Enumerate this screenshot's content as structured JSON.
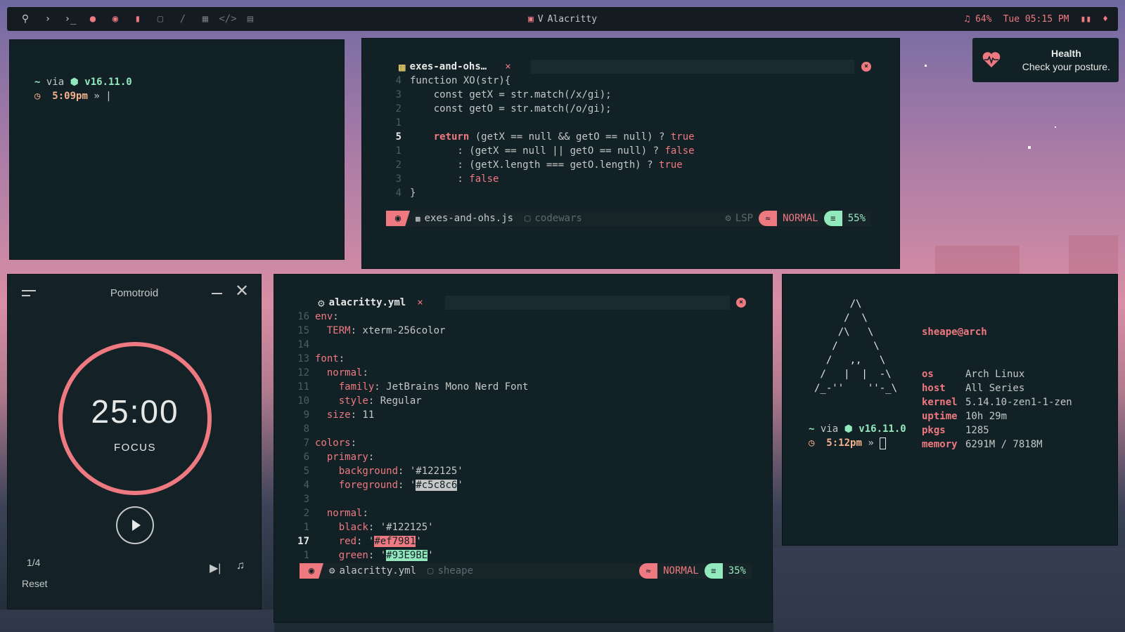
{
  "topbar": {
    "title": "Alacritty",
    "title_prefix": "V",
    "volume": "64%",
    "datetime": "Tue 05:15 PM",
    "icons": [
      "search-icon",
      "chevron-right-icon",
      "terminal-icon",
      "firefox-icon",
      "chrome-icon",
      "document-icon",
      "folder-icon",
      "brush-icon",
      "calculator-icon",
      "code-icon",
      "gamepad-icon"
    ]
  },
  "term1": {
    "tilde": "~",
    "via": "via",
    "node_version": "v16.11.0",
    "time": "5:09pm",
    "prompt": "»"
  },
  "notification": {
    "title": "Health",
    "body": "Check your posture."
  },
  "editor1": {
    "tab": "exes-and-ohs…",
    "tab_close": "×",
    "lines": [
      {
        "n": "4",
        "code": "function XO(str){"
      },
      {
        "n": "3",
        "code": "    const getX = str.match(/x/gi);"
      },
      {
        "n": "2",
        "code": "    const getO = str.match(/o/gi);"
      },
      {
        "n": "1",
        "code": ""
      },
      {
        "n": "5",
        "code": "    return (getX == null && getO == null) ? true",
        "current": true
      },
      {
        "n": "1",
        "code": "        : (getX == null || getO == null) ? false"
      },
      {
        "n": "2",
        "code": "        : (getX.length === getO.length) ? true"
      },
      {
        "n": "3",
        "code": "        : false"
      },
      {
        "n": "4",
        "code": "}"
      }
    ],
    "status": {
      "file": "exes-and-ohs.js",
      "folder": "codewars",
      "lsp": "LSP",
      "mode": "NORMAL",
      "percent": "55%"
    }
  },
  "pomotroid": {
    "title": "Pomotroid",
    "timer": "25:00",
    "label": "FOCUS",
    "round": "1/4",
    "reset": "Reset"
  },
  "editor2": {
    "tab": "alacritty.yml",
    "tab_close": "×",
    "status": {
      "file": "alacritty.yml",
      "folder": "sheape",
      "mode": "NORMAL",
      "percent": "35%"
    },
    "lines": [
      {
        "n": "16",
        "code": "env:"
      },
      {
        "n": "15",
        "code": "  TERM: xterm-256color"
      },
      {
        "n": "14",
        "code": ""
      },
      {
        "n": "13",
        "code": "font:"
      },
      {
        "n": "12",
        "code": "  normal:"
      },
      {
        "n": "11",
        "code": "    family: JetBrains Mono Nerd Font"
      },
      {
        "n": "10",
        "code": "    style: Regular"
      },
      {
        "n": "9",
        "code": "  size: 11"
      },
      {
        "n": "8",
        "code": ""
      },
      {
        "n": "7",
        "code": "colors:"
      },
      {
        "n": "6",
        "code": "  primary:"
      },
      {
        "n": "5",
        "code": "    background: '#122125'"
      },
      {
        "n": "4",
        "code": "    foreground: '#c5c8c6'"
      },
      {
        "n": "3",
        "code": ""
      },
      {
        "n": "2",
        "code": "  normal:"
      },
      {
        "n": "1",
        "code": "    black: '#122125'"
      },
      {
        "n": "17",
        "code": "    red: '#ef7981'",
        "current": true
      },
      {
        "n": "1",
        "code": "    green: '#93E9BE'"
      }
    ]
  },
  "fetch": {
    "logo": [
      "      /\\",
      "     /  \\",
      "    /\\   \\",
      "   /      \\",
      "  /   ,,   \\",
      " /   |  |  -\\",
      "/_-''    ''-_\\"
    ],
    "user": "sheape@arch",
    "info": [
      {
        "k": "os",
        "v": "Arch Linux"
      },
      {
        "k": "host",
        "v": "All Series"
      },
      {
        "k": "kernel",
        "v": "5.14.10-zen1-1-zen"
      },
      {
        "k": "uptime",
        "v": "10h 29m"
      },
      {
        "k": "pkgs",
        "v": "1285"
      },
      {
        "k": "memory",
        "v": "6291M / 7818M"
      }
    ],
    "tilde": "~",
    "via": "via",
    "node_version": "v16.11.0",
    "time": "5:12pm",
    "prompt": "»"
  },
  "colors": {
    "bg": "#122125",
    "fg": "#c5c8c6",
    "red": "#ef7981",
    "green": "#93E9BE"
  }
}
